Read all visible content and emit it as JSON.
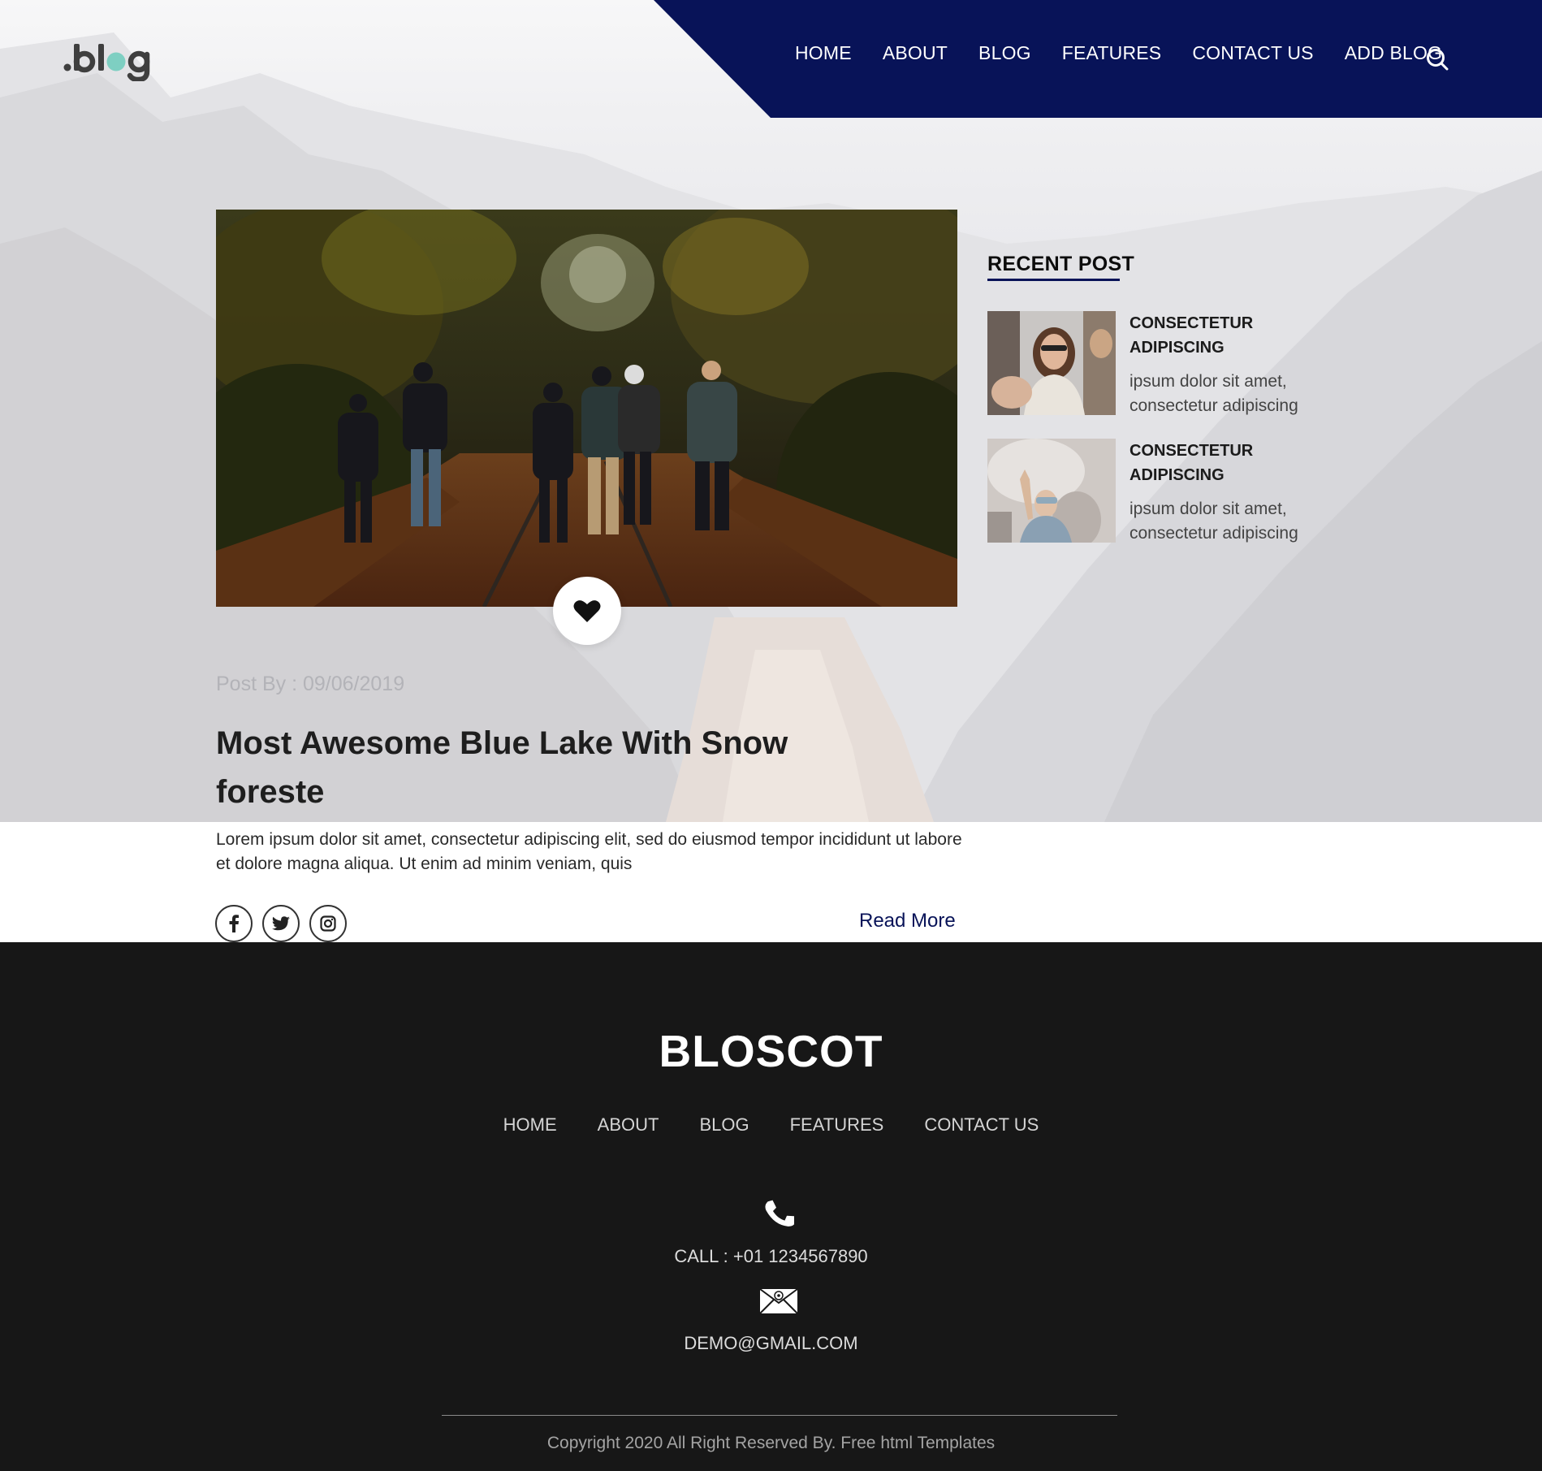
{
  "header": {
    "logo_text": ".blog",
    "nav": [
      "HOME",
      "ABOUT",
      "BLOG",
      "FEATURES",
      "CONTACT US",
      "ADD BLOG"
    ],
    "search_icon": "search-icon",
    "nav_bg_color": "#081358"
  },
  "post": {
    "image_alt": "Group of hikers walking on railway track through autumn forest",
    "like_icon": "heart-icon",
    "meta": "Post By : 09/06/2019",
    "title": "Most Awesome Blue Lake With Snow foreste",
    "excerpt": "Lorem ipsum dolor sit amet, consectetur adipiscing elit, sed do eiusmod tempor incididunt ut labore et dolore magna aliqua. Ut enim ad minim veniam, quis",
    "social_icons": [
      "facebook-icon",
      "twitter-icon",
      "instagram-icon"
    ],
    "read_more": "Read More"
  },
  "sidebar": {
    "title": "RECENT POST",
    "items": [
      {
        "heading": "CONSECTETUR ADIPISCING",
        "excerpt": "ipsum dolor sit amet, consectetur adipiscing"
      },
      {
        "heading": "CONSECTETUR ADIPISCING",
        "excerpt": "ipsum dolor sit amet, consectetur adipiscing"
      }
    ]
  },
  "footer": {
    "brand": "BLOSCOT",
    "nav": [
      "HOME",
      "ABOUT",
      "BLOG",
      "FEATURES",
      "CONTACT US"
    ],
    "phone_icon": "phone-icon",
    "call": "CALL : +01 1234567890",
    "mail_icon": "mail-icon",
    "email": "DEMO@GMAIL.COM",
    "copyright": "Copyright 2020 All Right Reserved By. Free html Templates",
    "bg_color": "#171717"
  }
}
